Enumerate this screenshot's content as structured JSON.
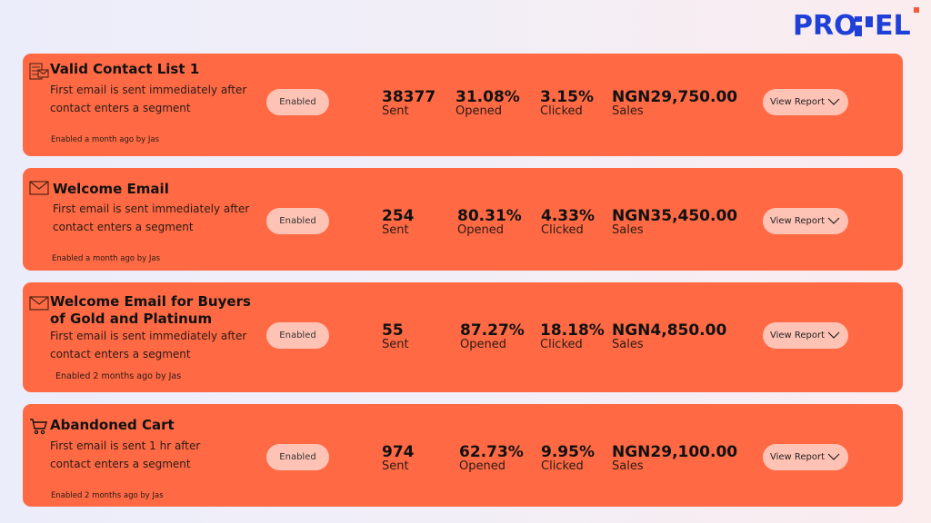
{
  "brand": {
    "logo_text": "PRO⌐EL",
    "logo_name": "PROPEL",
    "accent": "#1E3FD8",
    "dot_color": "#F25A3C"
  },
  "theme": {
    "card_color": "#FF6A45",
    "pill_color": "#FFC3B5"
  },
  "flows": [
    {
      "icon": "contact-list-email-icon",
      "title": "Valid Contact List 1",
      "description": "First email is sent immediately after contact enters a segment",
      "meta": "Enabled a month ago by Jas",
      "status": "Enabled",
      "sent": "38377",
      "sent_label": "Sent",
      "opened": "31.08%",
      "opened_label": "Opened",
      "clicked": "3.15%",
      "clicked_label": "Clicked",
      "sales": "NGN29,750.00",
      "sales_label": "Sales",
      "report_label": "View Report"
    },
    {
      "icon": "envelope-icon",
      "title": "Welcome Email",
      "description": "First email is sent immediately after contact enters a segment",
      "meta": "Enabled a month ago by Jas",
      "status": "Enabled",
      "sent": "254",
      "sent_label": "Sent",
      "opened": "80.31%",
      "opened_label": "Opened",
      "clicked": "4.33%",
      "clicked_label": "Clicked",
      "sales": "NGN35,450.00",
      "sales_label": "Sales",
      "report_label": "View Report"
    },
    {
      "icon": "envelope-icon",
      "title": "Welcome Email for Buyers of Gold and Platinum",
      "description": "First email is sent immediately after contact enters a segment",
      "meta": "Enabled 2 months ago by Jas",
      "status": "Enabled",
      "sent": "55",
      "sent_label": "Sent",
      "opened": "87.27%",
      "opened_label": "Opened",
      "clicked": "18.18%",
      "clicked_label": "Clicked",
      "sales": "NGN4,850.00",
      "sales_label": "Sales",
      "report_label": "View Report"
    },
    {
      "icon": "shopping-cart-icon",
      "title": "Abandoned Cart",
      "description": "First email is sent 1 hr after contact enters a segment",
      "meta": "Enabled 2 months ago by Jas",
      "status": "Enabled",
      "sent": "974",
      "sent_label": "Sent",
      "opened": "62.73%",
      "opened_label": "Opened",
      "clicked": "9.95%",
      "clicked_label": "Clicked",
      "sales": "NGN29,100.00",
      "sales_label": "Sales",
      "report_label": "View Report"
    }
  ]
}
